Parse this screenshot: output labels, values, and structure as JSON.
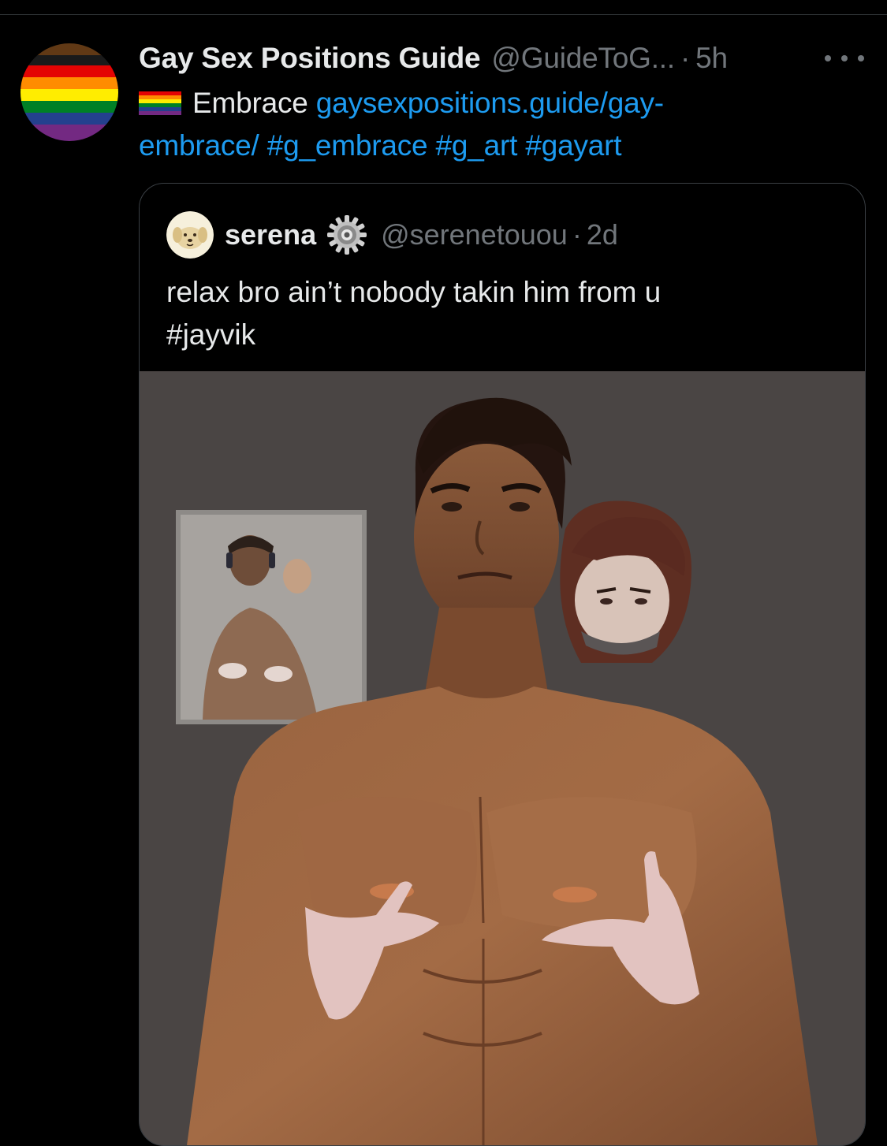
{
  "tweet": {
    "display_name": "Gay Sex Positions Guide",
    "handle": "@GuideToG...",
    "separator": "·",
    "time": "5h",
    "flag_icon": "rainbow-flag-icon",
    "text_word": "Embrace",
    "link_part1": "gaysexpositions.guide/gay-",
    "link_part2": "embrace/",
    "hashtags": [
      "#g_embrace",
      "#g_art",
      "#gayart"
    ],
    "more_icon": "more-horizontal-icon"
  },
  "quote": {
    "display_name": "serena",
    "badge_icon": "gear-icon",
    "handle": "@serenetouou",
    "separator": "·",
    "time": "2d",
    "text_line1": "relax bro ain’t nobody takin him from u",
    "text_line2": "#jayvik"
  },
  "colors": {
    "background": "#000000",
    "text_primary": "#e7e9ea",
    "text_secondary": "#71767b",
    "link": "#1d9bf0",
    "border": "#3a3f44"
  }
}
